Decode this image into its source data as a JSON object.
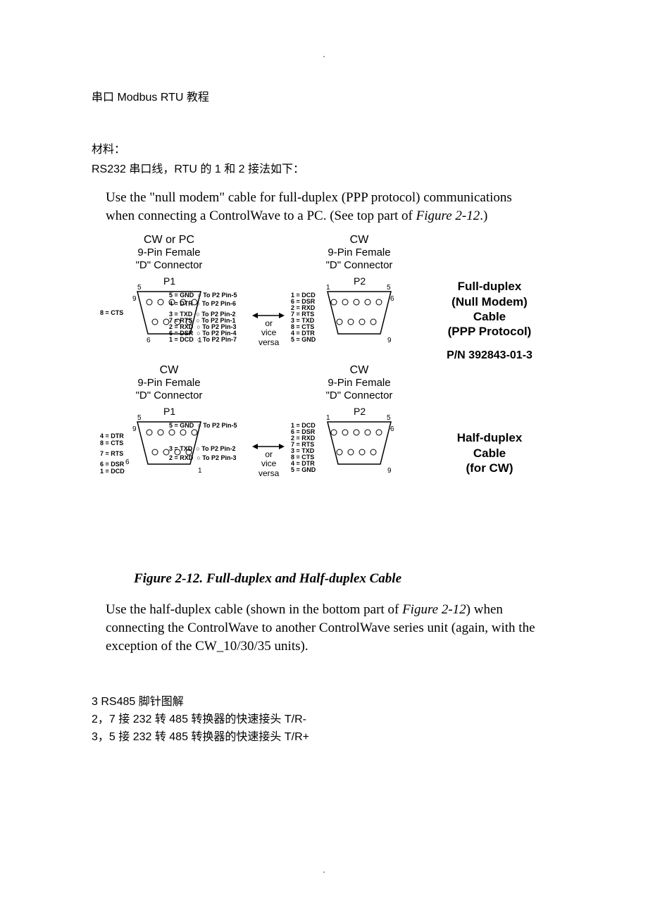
{
  "dot": ".",
  "title": "串口 Modbus RTU  教程",
  "materials_label": "材料：",
  "materials_line": "RS232 串口线，RTU 的 1 和 2  接法如下：",
  "intro_en_1": "Use the \"null modem\" cable for full-duplex (PPP protocol) communications when connecting a ControlWave to a PC. (See top part of ",
  "intro_en_fig": "Figure 2-12",
  "intro_en_2": ".)",
  "conn": {
    "top_left": {
      "l1": "CW or PC",
      "l2": "9-Pin Female",
      "l3": "\"D\" Connector"
    },
    "top_right": {
      "l1": "CW",
      "l2": "9-Pin Female",
      "l3": "\"D\" Connector"
    },
    "bot_left": {
      "l1": "CW",
      "l2": "9-Pin Female",
      "l3": "\"D\" Connector"
    },
    "bot_right": {
      "l1": "CW",
      "l2": "9-Pin Female",
      "l3": "\"D\" Connector"
    }
  },
  "p1": "P1",
  "p2": "P2",
  "side_full": {
    "l1": "Full-duplex",
    "l2": "(Null Modem)",
    "l3": "Cable",
    "l4": "(PPP Protocol)"
  },
  "pn_full": "P/N 392843-01-3",
  "side_half": {
    "l1": "Half-duplex",
    "l2": "Cable",
    "l3": "(for CW)"
  },
  "arrow_text": {
    "l1": "or",
    "l2": "vice",
    "l3": "versa"
  },
  "pins_p1_full": [
    "5 = GND",
    "4 = DTR",
    "3 = TXD",
    "7 = RTS",
    "2 = RXD",
    "8 = CTS",
    "6 = DSR",
    "1 = DCD"
  ],
  "pins_p1_to": [
    "To P2 Pin-5",
    "To P2 Pin-6",
    "To P2 Pin-2",
    "To P2 Pin-1",
    "To P2 Pin-3",
    "To P2 Pin-4",
    "To P2 Pin-7"
  ],
  "pins_p2_full": [
    "1 = DCD",
    "6 = DSR",
    "2 = RXD",
    "7 = RTS",
    "3 = TXD",
    "8 = CTS",
    "4 = DTR",
    "5 = GND"
  ],
  "pins_p1_half_top": "5 = GND",
  "pins_p1_half_top_to": "To P2 Pin-5",
  "pins_p1_half_mid1": "3 = TXD",
  "pins_p1_half_mid1_to": "To P2 Pin-2",
  "pins_p1_half_mid2": "2 = RXD",
  "pins_p1_half_mid2_to": "To P2 Pin-3",
  "pins_p2_half": [
    "1 = DCD",
    "6 = DSR",
    "2 = RXD",
    "7 = RTS",
    "3 = TXD",
    "8 = CTS",
    "4 = DTR",
    "5 = GND"
  ],
  "left_labels_full": {
    "cts": "8 = CTS"
  },
  "left_labels_half": {
    "dtr": "4 = DTR",
    "cts": "8 = CTS",
    "rts": "7 = RTS",
    "dsr": "6 = DSR",
    "dcd": "1 = DCD"
  },
  "num9": "9",
  "num6": "6",
  "num1": "1",
  "num5": "5",
  "caption": "Figure 2-12. Full-duplex and Half-duplex Cable",
  "para2_1": "Use the half-duplex cable (shown in the bottom part of ",
  "para2_fig": "Figure 2-12",
  "para2_2": ") when connecting the ControlWave to another ControlWave series unit (again, with the exception of the CW_10/30/35 units).",
  "notes": {
    "l1": " 3 RS485 脚针图解",
    "l2": "2，7  接 232 转 485 转换器的快速接头 T/R-",
    "l3": "3，5 接 232 转 485 转换器的快速接头 T/R+"
  }
}
